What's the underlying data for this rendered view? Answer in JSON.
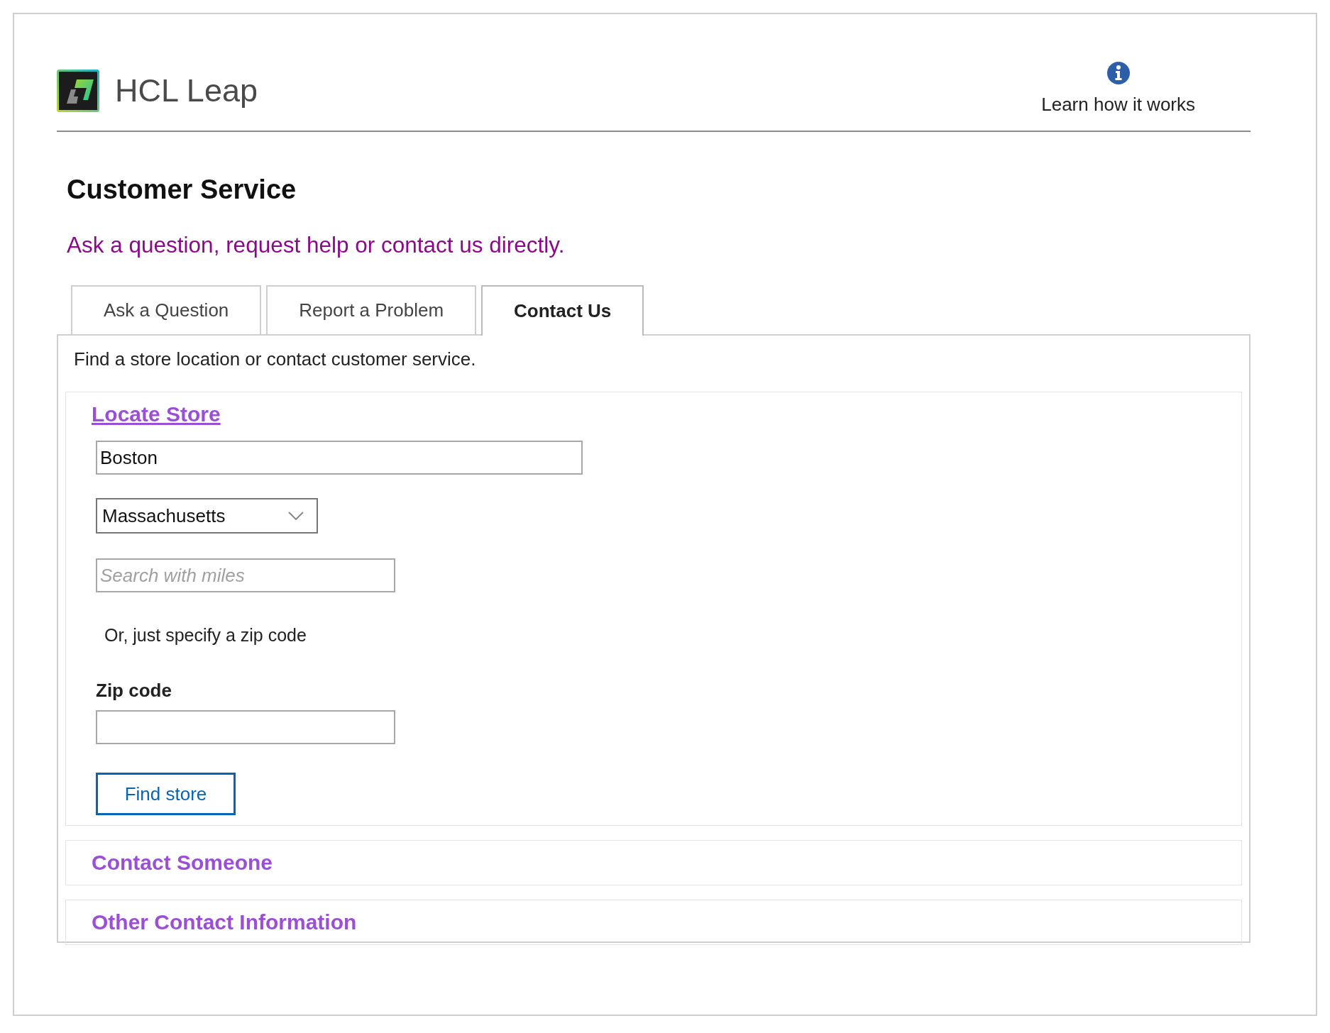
{
  "header": {
    "brand": "HCL Leap",
    "help_link": "Learn how it works"
  },
  "title": "Customer Service",
  "subtitle": "Ask a question, request help or contact us directly.",
  "tabs": [
    {
      "label": "Ask a Question",
      "selected": false
    },
    {
      "label": "Report a Problem",
      "selected": false
    },
    {
      "label": "Contact Us",
      "selected": true
    }
  ],
  "panel": {
    "description": "Find a store location or contact customer service.",
    "sections": [
      {
        "title": "Locate Store",
        "expanded": true,
        "items": [
          {
            "kind": "wide_text",
            "value": "Boston"
          },
          {
            "kind": "select",
            "value": "Massachusetts"
          },
          {
            "kind": "text",
            "placeholder": "Search with miles"
          },
          {
            "kind": "note",
            "text": "Or, just specify a zip code"
          },
          {
            "kind": "label",
            "text": "Zip code"
          },
          {
            "kind": "text",
            "value": ""
          }
        ],
        "button": "Find store"
      },
      {
        "title": "Contact Someone",
        "expanded": false
      },
      {
        "title": "Other Contact Information",
        "expanded": false
      }
    ]
  }
}
